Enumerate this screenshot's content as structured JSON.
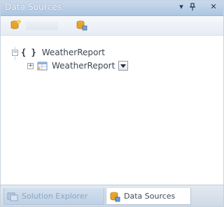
{
  "window": {
    "title": "Data Sources",
    "dropdown_glyph": "▾",
    "close_glyph": "✕"
  },
  "toolbar": {
    "buttons": [
      {
        "icon": "add-data-source-icon"
      },
      {
        "icon": "configure-icon"
      }
    ]
  },
  "tree": {
    "nodes": [
      {
        "label": "WeatherReport",
        "icon": "braces-icon",
        "expander": "−",
        "expanded": true,
        "level": 0
      },
      {
        "label": "WeatherReport",
        "icon": "dataset-icon",
        "expander": "+",
        "expanded": false,
        "level": 1,
        "has_dropdown": true
      }
    ],
    "braces_glyph": "{ }"
  },
  "tabs": [
    {
      "label": "Solution Explorer",
      "active": false,
      "icon": "solution-explorer-icon"
    },
    {
      "label": "Data Sources",
      "active": true,
      "icon": "data-sources-icon"
    }
  ],
  "colors": {
    "titlebar": "#b9cfe7",
    "accent_orange": "#e9a227",
    "tree_text": "#3c4652",
    "active_tab": "#ffffff"
  }
}
